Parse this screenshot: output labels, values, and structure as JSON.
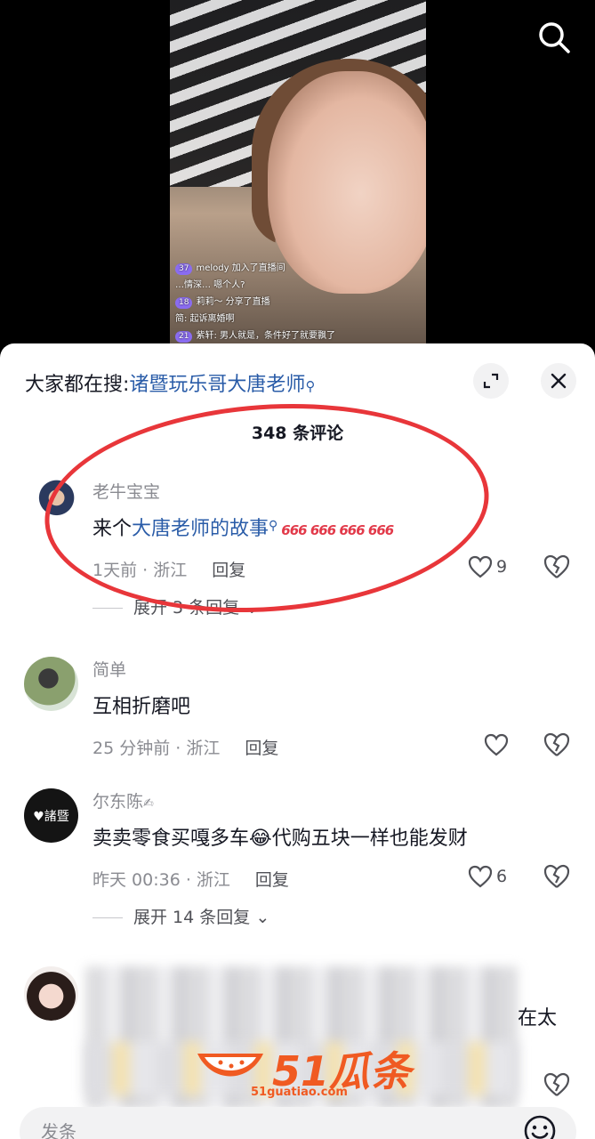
{
  "live": {
    "messages": [
      {
        "level": "37",
        "text": "melody 加入了直播间"
      },
      {
        "level": "",
        "text": "…情深…  嗯个人?"
      },
      {
        "level": "18",
        "text": "莉莉～ 分享了直播"
      },
      {
        "level": "",
        "text": "简:  起诉离婚啊"
      },
      {
        "level": "21",
        "text": "紫轩:  男人就是，条件好了就要飘了"
      }
    ]
  },
  "sheet": {
    "search_prefix": "大家都在搜:",
    "search_keyword": "诸暨玩乐哥大唐老师",
    "comment_count": "348 条评论"
  },
  "comments": [
    {
      "user": "老牛宝宝",
      "text_prefix": "来个",
      "text_keyword": "大唐老师的故事",
      "emoji": "666 666 666 666",
      "time_loc": "1天前 · 浙江",
      "reply": "回复",
      "likes": "9",
      "expand": "展开 3 条回复"
    },
    {
      "user": "简单",
      "text": "互相折磨吧",
      "time_loc": "25 分钟前 · 浙江",
      "reply": "回复",
      "likes": ""
    },
    {
      "user": "尔东陈",
      "avatar_text": "♥諸暨",
      "text": "卖卖零食买嘎多车😂代购五块一样也能发财",
      "time_loc": "昨天 00:36 · 浙江",
      "reply": "回复",
      "likes": "6",
      "expand": "展开 14 条回复"
    },
    {
      "user": "",
      "text_tail": "在太",
      "time_loc": "",
      "likes": ""
    }
  ],
  "watermark": {
    "text": "51瓜条",
    "sub": "51guatiao.com"
  },
  "input": {
    "placeholder": "发条"
  },
  "colors": {
    "accent_link": "#2a5ca8",
    "annotation": "#e8363a",
    "watermark": "#f05a22"
  }
}
